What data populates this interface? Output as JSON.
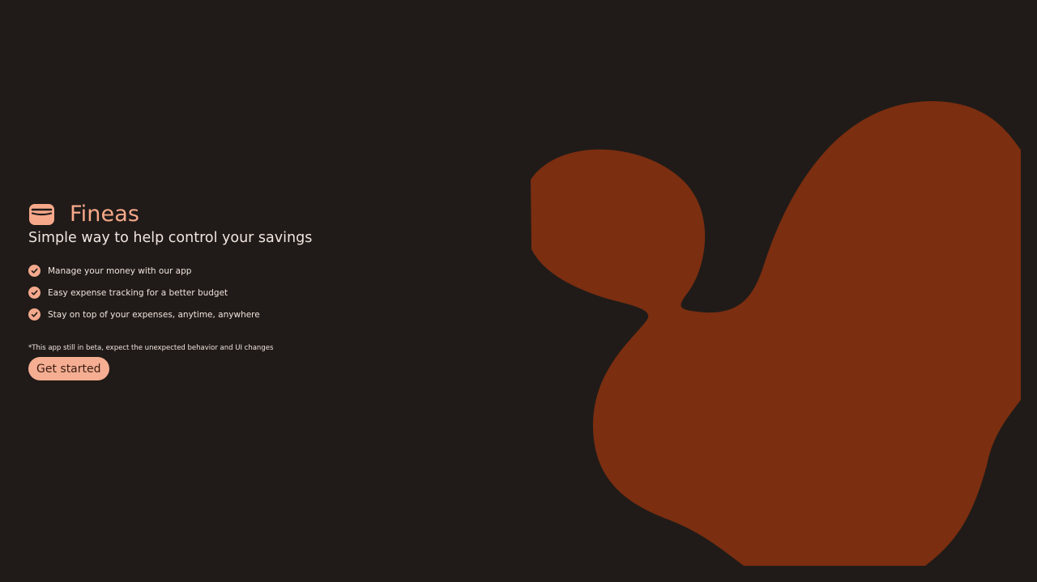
{
  "brand": {
    "name": "Fineas",
    "icon": "wallet-icon",
    "accent_color": "#f7a88a"
  },
  "tagline": "Simple way to help control your savings",
  "features": [
    {
      "icon": "check-circle-icon",
      "text": "Manage your money with our app"
    },
    {
      "icon": "check-circle-icon",
      "text": "Easy expense tracking for a better budget"
    },
    {
      "icon": "check-circle-icon",
      "text": "Stay on top of your expenses, anytime, anywhere"
    }
  ],
  "beta_notice": "*This app still in beta, expect the unexpected behavior and UI changes",
  "cta": {
    "label": "Get started",
    "color": "#f5ae92"
  },
  "colors": {
    "background": "#201b18",
    "blob": "#7b2e10"
  }
}
